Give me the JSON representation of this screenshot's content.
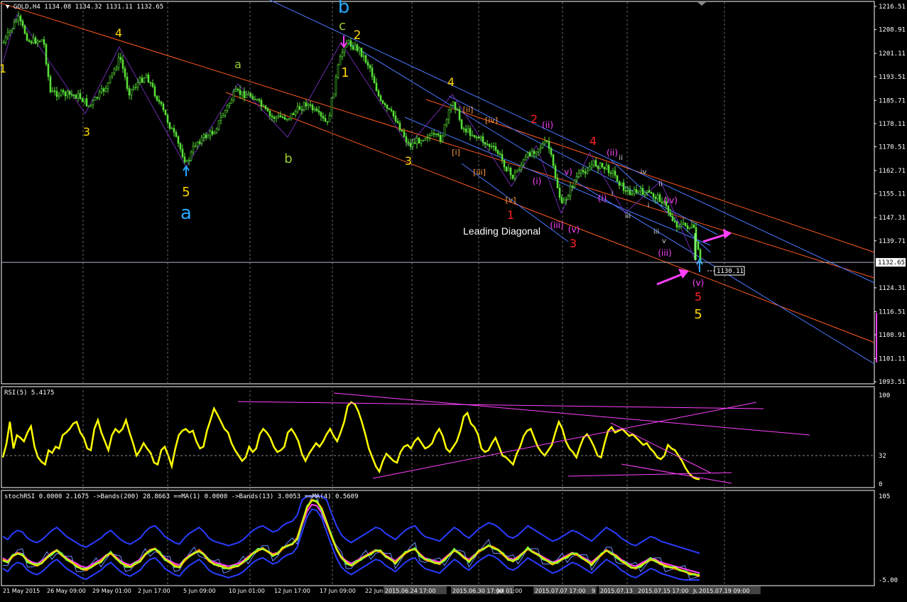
{
  "chart_data": [
    {
      "type": "candlestick",
      "symbol": "GOLD,H4",
      "ohlc": {
        "open": "1134.08",
        "high": "1134.32",
        "low": "1131.11",
        "close": "1132.65"
      },
      "ylim": [
        1093.55,
        1216.51
      ],
      "yticks": [
        "1216.51",
        "1208.91",
        "1201.11",
        "1193.51",
        "1185.71",
        "1178.11",
        "1170.51",
        "1162.71",
        "1155.11",
        "1147.31",
        "1139.71",
        "1132.65",
        "1124.31",
        "1116.51",
        "1108.91",
        "1101.11",
        "1093.51"
      ],
      "current_price": "1132.65",
      "marked_price": "1130.11",
      "annotation": "Leading Diagonal",
      "wave_labels": [
        {
          "t": "b",
          "c": "#28a8ff"
        },
        {
          "t": "c",
          "c": "#9acd32"
        },
        {
          "t": "1",
          "c": "#ffd700"
        },
        {
          "t": "2",
          "c": "#ffd700"
        },
        {
          "t": "4",
          "c": "#ffd700"
        },
        {
          "t": "3",
          "c": "#ffd700"
        },
        {
          "t": "5",
          "c": "#ffd700"
        },
        {
          "t": "a",
          "c": "#28a8ff"
        },
        {
          "t": "a",
          "c": "#9acd32"
        },
        {
          "t": "b",
          "c": "#9acd32"
        },
        {
          "t": "1",
          "c": "#ffd700"
        },
        {
          "t": "4",
          "c": "#ffd700"
        },
        {
          "t": "3",
          "c": "#ffd700"
        },
        {
          "t": "[ii]",
          "c": "#ff9a3c"
        },
        {
          "t": "[iv]",
          "c": "#ff9a3c"
        },
        {
          "t": "[i]",
          "c": "#ff9a3c"
        },
        {
          "t": "[iii]",
          "c": "#ff9a3c"
        },
        {
          "t": "[v]",
          "c": "#ff9a3c"
        },
        {
          "t": "1",
          "c": "#ff2020"
        },
        {
          "t": "2",
          "c": "#ff2020"
        },
        {
          "t": "3",
          "c": "#ff2020"
        },
        {
          "t": "4",
          "c": "#ff2020"
        },
        {
          "t": "5",
          "c": "#ff2020"
        },
        {
          "t": "5",
          "c": "#ffd700"
        },
        {
          "t": "(ii)",
          "c": "#ff44ff"
        },
        {
          "t": "(i)",
          "c": "#ff44ff"
        },
        {
          "t": "(iii)",
          "c": "#ff44ff"
        },
        {
          "t": "(v)",
          "c": "#ff44ff"
        },
        {
          "t": "(ii)",
          "c": "#ff44ff"
        },
        {
          "t": "(i)",
          "c": "#ff44ff"
        },
        {
          "t": "(iv)",
          "c": "#ff44ff"
        },
        {
          "t": "(iii)",
          "c": "#ff44ff"
        },
        {
          "t": "(v)",
          "c": "#ff44ff"
        },
        {
          "t": "v)",
          "c": "#ff44ff"
        },
        {
          "t": "ii",
          "c": "#cccccc"
        },
        {
          "t": "i",
          "c": "#cccccc"
        },
        {
          "t": "iv",
          "c": "#cccccc"
        },
        {
          "t": "ii",
          "c": "#cccccc"
        },
        {
          "t": "i",
          "c": "#cccccc"
        },
        {
          "t": "iii",
          "c": "#cccccc"
        },
        {
          "t": "iii",
          "c": "#cccccc"
        },
        {
          "t": "v",
          "c": "#cccccc"
        }
      ]
    },
    {
      "type": "line",
      "name": "RSI(5) 5.4175",
      "yticks": [
        "100",
        "32",
        "0"
      ],
      "ylim": [
        0,
        100
      ],
      "level": 32,
      "values": [
        30,
        45,
        70,
        40,
        55,
        52,
        48,
        58,
        65,
        42,
        30,
        25,
        22,
        38,
        35,
        42,
        40,
        55,
        58,
        62,
        68,
        70,
        58,
        52,
        40,
        38,
        62,
        72,
        58,
        48,
        38,
        55,
        62,
        58,
        62,
        72,
        58,
        46,
        32,
        38,
        46,
        40,
        35,
        24,
        22,
        38,
        42,
        32,
        20,
        40,
        55,
        60,
        62,
        58,
        60,
        48,
        40,
        42,
        60,
        72,
        85,
        78,
        70,
        62,
        58,
        46,
        38,
        32,
        26,
        30,
        42,
        36,
        40,
        56,
        62,
        58,
        52,
        42,
        36,
        38,
        42,
        58,
        62,
        56,
        48,
        34,
        26,
        34,
        40,
        46,
        42,
        48,
        56,
        62,
        54,
        48,
        58,
        70,
        88,
        92,
        90,
        82,
        70,
        56,
        40,
        30,
        20,
        14,
        26,
        34,
        30,
        26,
        24,
        36,
        42,
        44,
        40,
        48,
        52,
        46,
        40,
        42,
        46,
        56,
        62,
        54,
        40,
        36,
        42,
        48,
        60,
        76,
        80,
        68,
        64,
        56,
        40,
        36,
        38,
        46,
        52,
        42,
        32,
        30,
        26,
        22,
        34,
        42,
        54,
        60,
        62,
        52,
        42,
        36,
        32,
        38,
        44,
        58,
        70,
        62,
        48,
        40,
        36,
        30,
        42,
        52,
        56,
        50,
        42,
        32,
        30,
        46,
        60,
        64,
        58,
        60,
        62,
        58,
        54,
        56,
        52,
        48,
        44,
        46,
        40,
        36,
        30,
        28,
        32,
        44,
        40,
        38,
        32,
        26,
        18,
        12,
        8,
        6,
        5.4
      ]
    },
    {
      "type": "line",
      "name": "stochRSI 0.0000 2.1675 ->Bands(200) 28.8663 ==MA(1) 0.0000 ->Bands(13) 3.0053 ==MA(4) 0.5609",
      "yticks": [
        "105",
        "-5.00"
      ],
      "ylim": [
        -5,
        105
      ],
      "values": [
        22,
        18,
        26,
        30,
        28,
        20,
        16,
        14,
        18,
        24,
        30,
        34,
        28,
        22,
        18,
        14,
        10,
        8,
        12,
        16,
        20,
        26,
        30,
        24,
        18,
        14,
        12,
        16,
        20,
        28,
        34,
        36,
        30,
        22,
        18,
        14,
        12,
        20,
        26,
        30,
        34,
        28,
        20,
        16,
        14,
        12,
        10,
        12,
        14,
        18,
        24,
        30,
        34,
        36,
        32,
        28,
        30,
        36,
        40,
        42,
        50,
        70,
        90,
        100,
        98,
        88,
        70,
        52,
        36,
        24,
        18,
        14,
        18,
        22,
        26,
        30,
        34,
        32,
        26,
        22,
        18,
        24,
        30,
        34,
        36,
        28,
        22,
        20,
        18,
        16,
        22,
        28,
        34,
        30,
        24,
        20,
        26,
        32,
        36,
        40,
        38,
        34,
        28,
        22,
        20,
        24,
        30,
        36,
        32,
        28,
        24,
        20,
        16,
        18,
        22,
        26,
        30,
        28,
        24,
        20,
        16,
        22,
        28,
        34,
        30,
        26,
        20,
        16,
        12,
        10,
        14,
        18,
        22,
        20,
        16,
        14,
        12,
        10,
        8,
        6,
        4,
        2,
        0
      ]
    }
  ],
  "time_axis": [
    "21 May 2015",
    "26 May 09:00",
    "29 May 01:00",
    "2 Jun 17:00",
    "5 Jun 09:00",
    "10 Jun 01:00",
    "12 Jun 17:00",
    "17 Jun 09:00",
    "22 Jun",
    "2015.06.24 17:00",
    "2015.06.30 17:00",
    "Jul 01:00",
    "2015.07.07 17:00",
    "9",
    "2015.07.13",
    "2015.07.15 17:00",
    "Jul",
    "2015.07.19 09:00"
  ]
}
